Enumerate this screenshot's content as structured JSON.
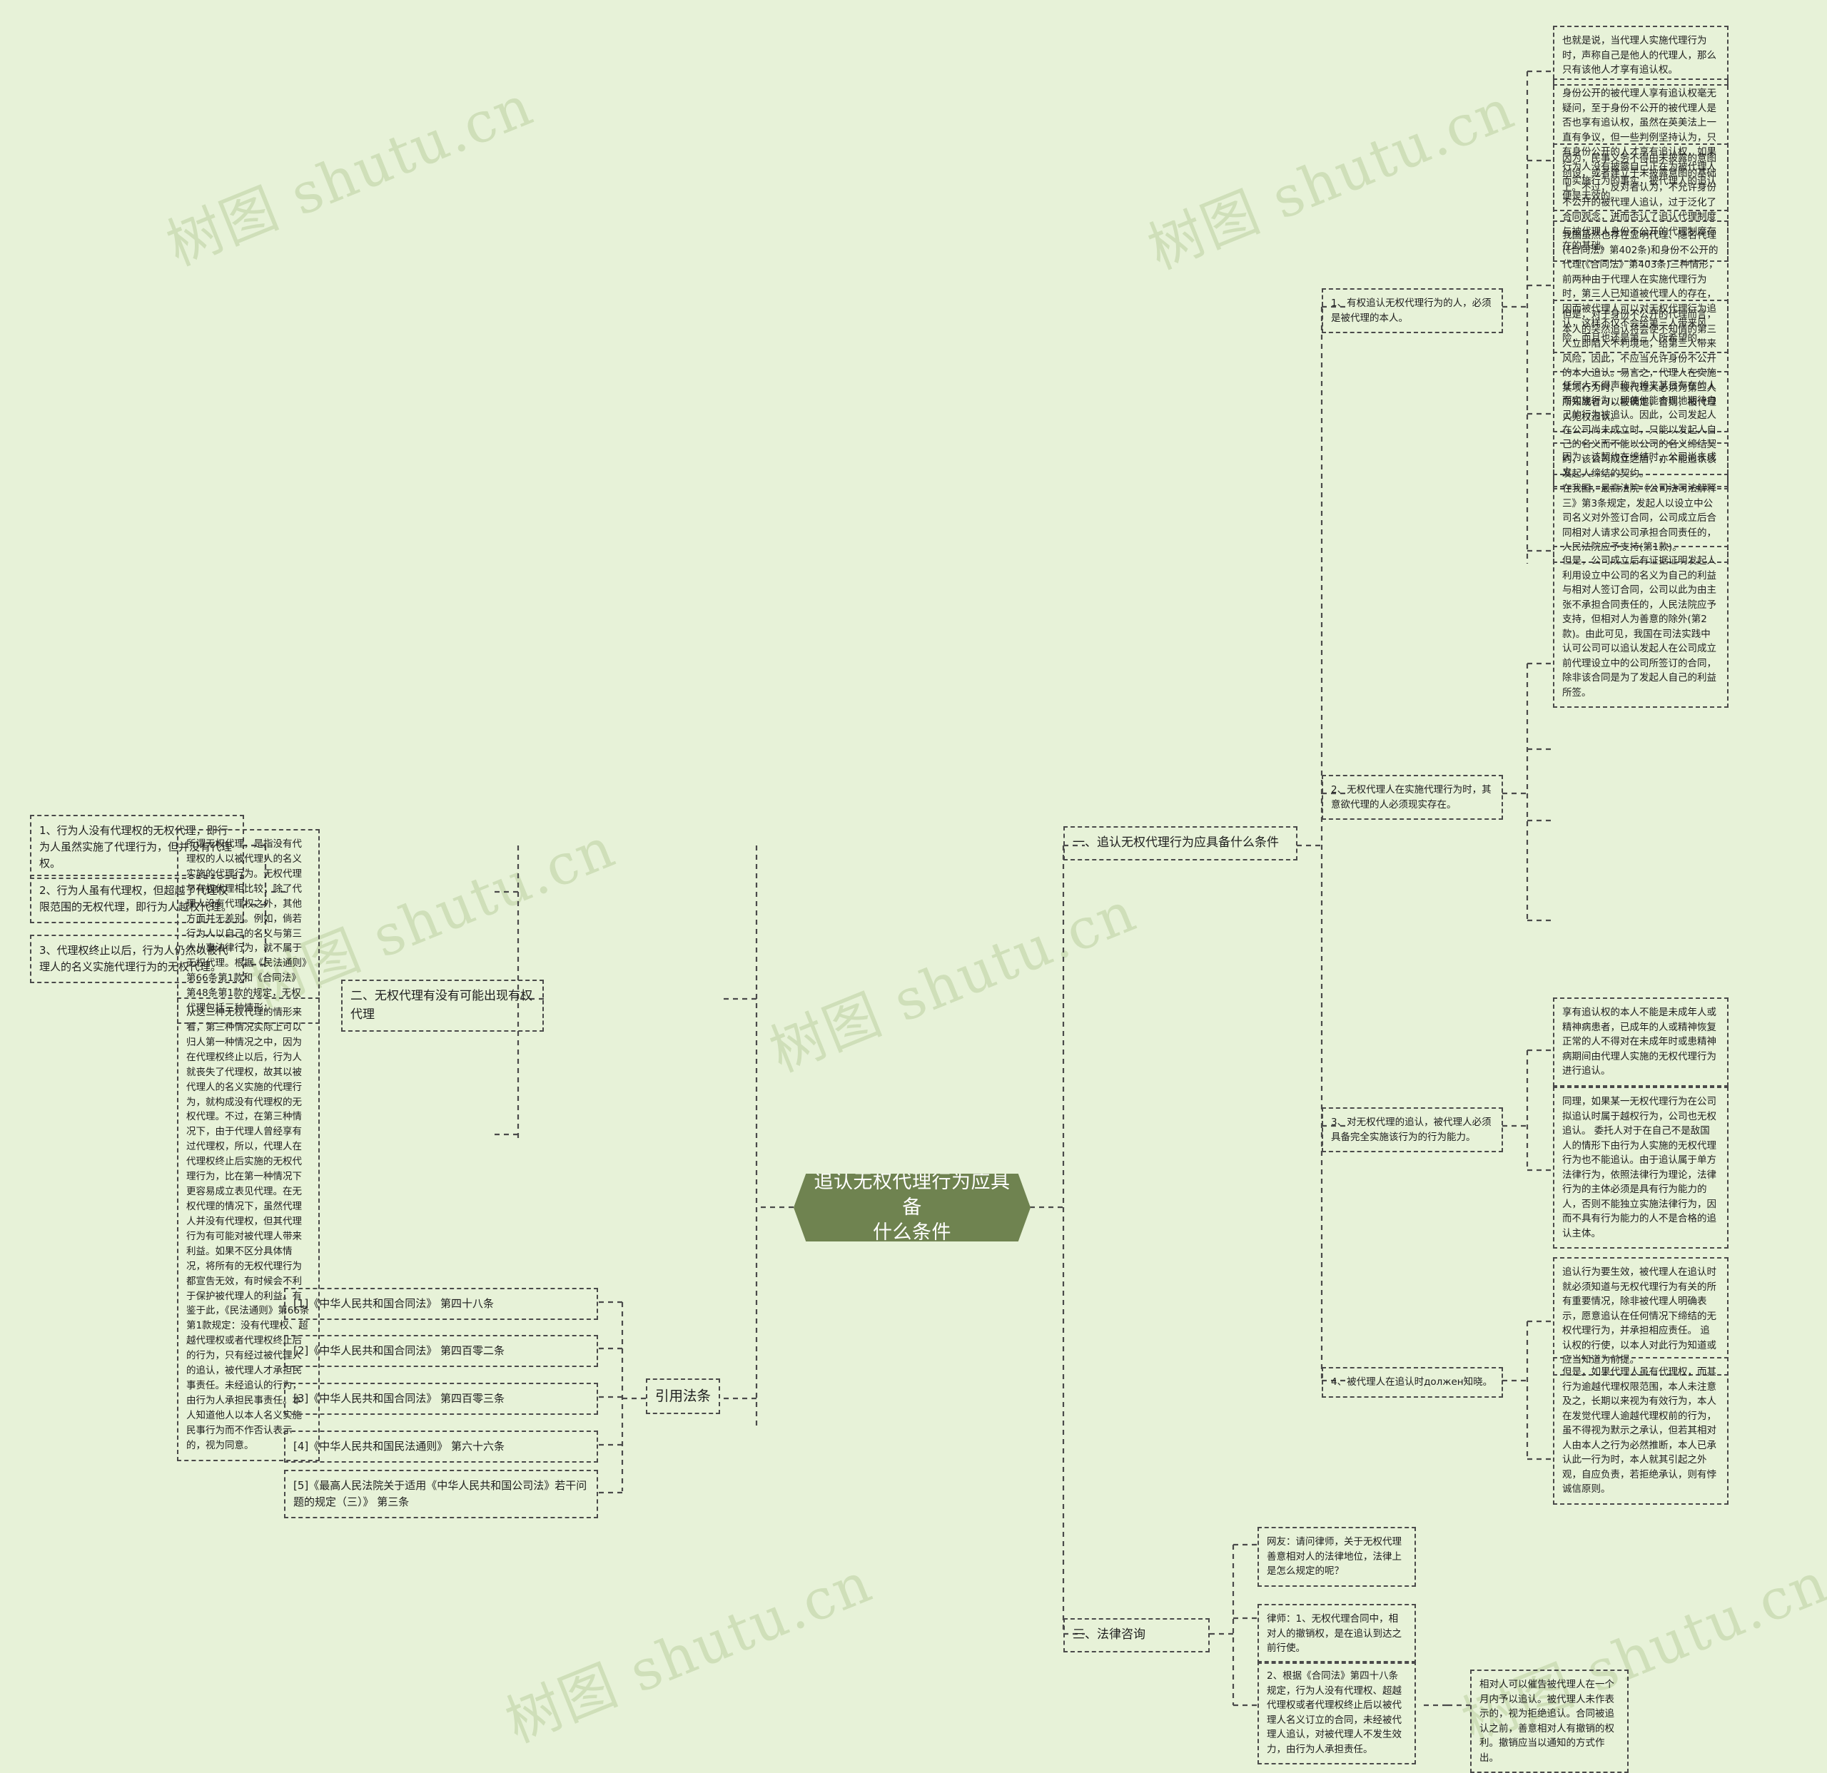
{
  "meta": {
    "watermark_text": "树图 shutu.cn",
    "bg_color": "#e7f2d8",
    "root_color": "#6f8350",
    "node_border_color": "#4a4a4a",
    "text_color": "#1d1d1d"
  },
  "root": {
    "line1": "追认无权代理行为应具备",
    "line2": "什么条件"
  },
  "branches": {
    "definition": {
      "items": [
        "1、行为人没有代理权的无权代理，即行为人虽然实施了代理行为，但并没有代理权。",
        "2、行为人虽有代理权，但超越了代理权限范围的无权代理，即行为人越权代理。",
        "3、代理权终止以后，行为人仍然以被代理人的名义实施代理行为的无权代理。"
      ],
      "parent": "所谓无权代理，是指没有代理权的人以被代理人的名义实施的代理行为。无权代理与有权代理相比较，除了代理人没有代理权之外，其他方面并无差别。例如，倘若行为人以自己的名义与第三人从事法律行为，就不属于无权代理。根据《民法通则》第66条第1款和《合同法》第48条第1款的规定，无权代理包括三种情形：",
      "analysis": "从这三种无权代理的情形来看，第三种情况实际上可以归人第一种情况之中，因为在代理权终止以后，行为人就丧失了代理权，故其以被代理人的名义实施的代理行为，就构成没有代理权的无权代理。不过，在第三种情况下，由于代理人曾经享有过代理权，所以，代理人在代理权终止后实施的无权代理行为，比在第一种情况下更容易成立表见代理。在无权代理的情况下，虽然代理人并没有代理权，但其代理行为有可能对被代理人带来利益。如果不区分具体情况，将所有的无权代理行为都宣告无效，有时候会不利于保护被代理人的利益。有鉴于此，《民法通则》第66条第1款规定：没有代理权、超越代理权或者代理权终止后的行为，只有经过被代理人的追认，被代理人才承担民事责任。未经追认的行为，由行为人承担民事责任。本人知道他人以本人名义实施民事行为而不作否认表示的，视为同意。",
      "section2_title": "二、无权代理有没有可能出现有权代理"
    },
    "laws": {
      "title": "引用法条",
      "items": [
        "[1]《中华人民共和国合同法》 第四十八条",
        "[2]《中华人民共和国合同法》 第四百零二条",
        "[3]《中华人民共和国合同法》 第四百零三条",
        "[4]《中华人民共和国民法通则》 第六十六条",
        "[5]《最高人民法院关于适用《中华人民共和国公司法》若干问题的规定（三）》 第三条"
      ]
    },
    "section1": {
      "title": "一、追认无权代理行为应具备什么条件",
      "conditions": [
        {
          "label": "1、有权追认无权代理行为的人，必须是被代理的本人。",
          "details": [
            "也就是说，当代理人实施代理行为时，声称自己是他人的代理人，那么只有该他人才享有追认权。",
            "身份公开的被代理人享有追认权毫无疑问，至于身份不公开的被代理人是否也享有追认权，虽然在英美法上一直有争议，但一些判例坚持认为，只有身份公开的人才享有追认权，如果行为人没有披露自己正在为被代理人而实施行为的事实，被代理人的追认便是无效的。",
            "因为，民事义务不得由未披露的意图创设，或者建立于未披露意图的基础上。不过，反对者认为，不允许身份不公开的被代理人追认，过于泛化了合同观念，进而否认了追认代理制度与被代理人身份不公开的代理制度存在的基础。",
            "我国虽然也存在显明代理、隐名代理(《合同法》第402条)和身份不公开的代理(《合同法》第403条)三种情形，前两种由于代理人在实施代理行为时，第三人已知道被代理人的存在，因而被代理人可以对无权代理行为追认，这样不仅不会给第三人带来风险，而且也还是第三人所希望的。",
            "但是，对于身份不公开的代理而言，本人的突然追认将会使不知情的第三人立即陷入不利境地，给第三人带来风险，因此，不应当允许身份不公开的本人追认。易言之，代理人在实施某项行为时，被代理人必须为第三人所知或者可以被确定，否则，被代理人无权追认。"
          ]
        },
        {
          "label": "2、无权代理人在实施代理行为时，其意欲代理的人必须现实存在。",
          "details": [
            "任何人不得声称为将来某日存在的人而实施行为，即使他能合理地期待自己的行为被追认。因此，公司发起人在公司尚未成立时，只能以发起人自己的名义而不能以公司的名义缔结契约，该公司成立之后，亦不能追认该发起人缔结的契约。",
            "因为，该契约在缔结时，公司尚未成立。",
            "在我国，最高法院《公司法司法解释三》第3条规定，发起人以设立中公司名义对外签订合同，公司成立后合同相对人请求公司承担合同责任的，人民法院应予支持(第1款)。",
            "但是，公司成立后有证据证明发起人利用设立中公司的名义为自己的利益与相对人签订合同，公司以此为由主张不承担合同责任的，人民法院应予支持，但相对人为善意的除外(第2款)。由此可见，我国在司法实践中认可公司可以追认发起人在公司成立前代理设立中的公司所签订的合同，除非该合同是为了发起人自己的利益所签。"
          ]
        },
        {
          "label": "3、对无权代理的追认，被代理人必须具备完全实施该行为的行为能力。",
          "details": [
            "享有追认权的本人不能是未成年人或精神病患者，已成年的人或精神恢复正常的人不得对在未成年时或患精神病期间由代理人实施的无权代理行为进行追认。",
            "同理，如果某一无权代理行为在公司拟追认时属于越权行为，公司也无权追认。 委托人对于在自己不是敌国人的情形下由行为人实施的无权代理行为也不能追认。由于追认属于单方法律行为，依照法律行为理论，法律行为的主体必须是具有行为能力的人，否则不能独立实施法律行为，因而不具有行为能力的人不是合格的追认主体。"
          ]
        },
        {
          "label": "4、被代理人在追认时должен知晓。",
          "details": [
            "追认行为要生效，被代理人在追认时就必须知道与无权代理行为有关的所有重要情况，除非被代理人明确表示，愿意追认在任何情况下缔结的无权代理行为，并承担相应责任。 追认权的行使，以本人对此行为知道或应当知道为前提。",
            "但是，如果代理人虽有代理权，而其行为逾越代理权限范围，本人未注意及之，长期以来视为有效行为，本人在发觉代理人逾越代理权前的行为，虽不得视为默示之承认，但若其相对人由本人之行为必然推断，本人已承认此一行为时，本人就其引起之外观，自应负责，若拒绝承认，则有悖诚信原则。"
          ]
        }
      ]
    },
    "section3": {
      "title": "三、法律咨询",
      "question": "网友：请问律师，关于无权代理善意相对人的法律地位，法律上是怎么规定的呢？",
      "answers": [
        "律师：1、无权代理合同中，相对人的撤销权，是在追认到达之前行使。",
        "2、根据《合同法》第四十八条规定，行为人没有代理权、超越代理权或者代理权终止后以被代理人名义订立的合同，未经被代理人追认，对被代理人不发生效力，由行为人承担责任。"
      ],
      "note": "相对人可以催告被代理人在一个月内予以追认。被代理人未作表示的，视为拒绝追认。合同被追认之前，善意相对人有撤销的权利。撤销应当以通知的方式作出。"
    }
  }
}
